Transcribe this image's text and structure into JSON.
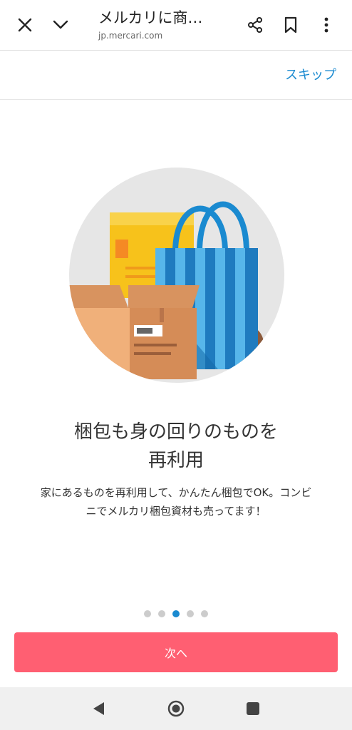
{
  "browser": {
    "title": "メルカリに商…",
    "url": "jp.mercari.com",
    "icons": [
      "close-icon",
      "chevron-down-icon",
      "share-icon",
      "bookmark-icon",
      "more-vert-icon"
    ]
  },
  "onboarding": {
    "skip_label": "スキップ",
    "headline_line1": "梱包も身の回りのものを",
    "headline_line2": "再利用",
    "body_line1": "家にあるものを再利用して、かんたん梱包でOK。コンビ",
    "body_line2": "ニでメルカリ梱包資材も売ってます！",
    "page_count": 5,
    "active_page": 3,
    "next_label": "次へ"
  },
  "colors": {
    "accent": "#1a8ad0",
    "button": "#ff5f72",
    "dot_inactive": "#cccccc"
  },
  "system_nav": {
    "icons": [
      "back-icon",
      "home-icon",
      "recents-icon"
    ]
  }
}
